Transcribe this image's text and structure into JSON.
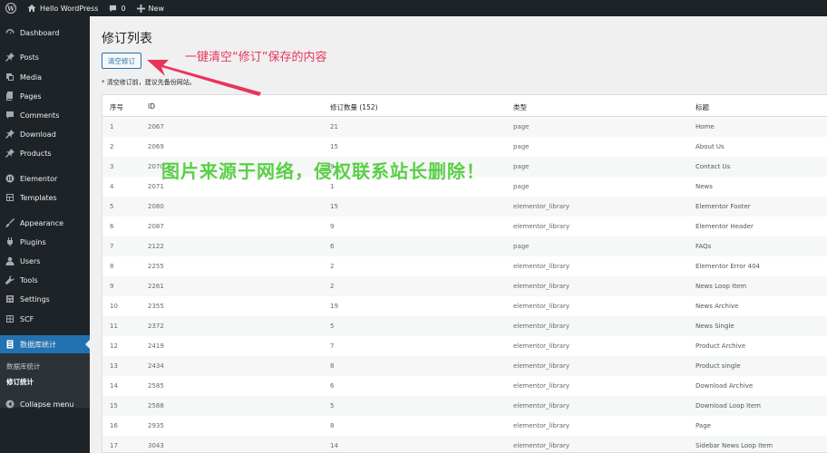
{
  "adminbar": {
    "site_name": "Hello WordPress",
    "comments_count": "0",
    "new_label": "New"
  },
  "sidebar": {
    "items": [
      {
        "label": "Dashboard",
        "icon": "dashboard-icon"
      },
      {
        "label": "Posts",
        "icon": "pin-icon"
      },
      {
        "label": "Media",
        "icon": "media-icon"
      },
      {
        "label": "Pages",
        "icon": "pages-icon"
      },
      {
        "label": "Comments",
        "icon": "comment-icon"
      },
      {
        "label": "Download",
        "icon": "pin-icon"
      },
      {
        "label": "Products",
        "icon": "pin-icon"
      },
      {
        "label": "Elementor",
        "icon": "elementor-icon"
      },
      {
        "label": "Templates",
        "icon": "templates-icon"
      },
      {
        "label": "Appearance",
        "icon": "brush-icon"
      },
      {
        "label": "Plugins",
        "icon": "plugin-icon"
      },
      {
        "label": "Users",
        "icon": "user-icon"
      },
      {
        "label": "Tools",
        "icon": "wrench-icon"
      },
      {
        "label": "Settings",
        "icon": "settings-icon"
      },
      {
        "label": "SCF",
        "icon": "grid-icon"
      },
      {
        "label": "数据库统计",
        "icon": "database-icon"
      }
    ],
    "submenu": [
      "数据库统计",
      "修订统计"
    ],
    "collapse_label": "Collapse menu"
  },
  "main": {
    "title": "修订列表",
    "clear_button": "清空修订",
    "note": "* 清空修订前，建议先备份网站。",
    "annotation": "一键清空“修订”保存的内容",
    "watermark": "图片来源于网络，侵权联系站长删除！",
    "columns": [
      "序号",
      "ID",
      "修订数量 (152)",
      "类型",
      "标题"
    ],
    "rows": [
      [
        "1",
        "2067",
        "21",
        "page",
        "Home"
      ],
      [
        "2",
        "2069",
        "15",
        "page",
        "About Us"
      ],
      [
        "3",
        "2070",
        "9",
        "page",
        "Contact Us"
      ],
      [
        "4",
        "2071",
        "1",
        "page",
        "News"
      ],
      [
        "5",
        "2080",
        "15",
        "elementor_library",
        "Elementor Footer"
      ],
      [
        "6",
        "2087",
        "9",
        "elementor_library",
        "Elementor Header"
      ],
      [
        "7",
        "2122",
        "6",
        "page",
        "FAQs"
      ],
      [
        "8",
        "2255",
        "2",
        "elementor_library",
        "Elementor Error 404"
      ],
      [
        "9",
        "2261",
        "2",
        "elementor_library",
        "News Loop Item"
      ],
      [
        "10",
        "2355",
        "19",
        "elementor_library",
        "News Archive"
      ],
      [
        "11",
        "2372",
        "5",
        "elementor_library",
        "News Single"
      ],
      [
        "12",
        "2419",
        "7",
        "elementor_library",
        "Product Archive"
      ],
      [
        "13",
        "2434",
        "8",
        "elementor_library",
        "Product single"
      ],
      [
        "14",
        "2585",
        "6",
        "elementor_library",
        "Download Archive"
      ],
      [
        "15",
        "2588",
        "5",
        "elementor_library",
        "Download Loop Item"
      ],
      [
        "16",
        "2935",
        "8",
        "elementor_library",
        "Page"
      ],
      [
        "17",
        "3043",
        "14",
        "elementor_library",
        "Sidebar News Loop Item"
      ]
    ]
  }
}
